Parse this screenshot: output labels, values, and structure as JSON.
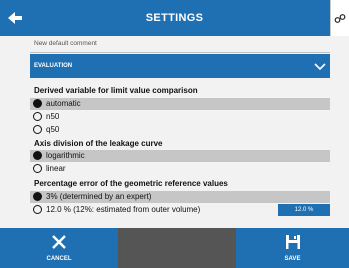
{
  "header": {
    "title": "SETTINGS",
    "back_icon": "back-arrow-icon",
    "corner_icon": "tools-icon"
  },
  "comment": {
    "text": "New default comment"
  },
  "section": {
    "label": "EVALUATION",
    "chevron_icon": "chevron-down-icon"
  },
  "groups": [
    {
      "title": "Derived variable for limit value comparison",
      "options": [
        {
          "label": "automatic",
          "selected": true
        },
        {
          "label": "n50",
          "selected": false
        },
        {
          "label": "q50",
          "selected": false
        }
      ]
    },
    {
      "title": "Axis division of the leakage curve",
      "options": [
        {
          "label": "logarithmic",
          "selected": true
        },
        {
          "label": "linear",
          "selected": false
        }
      ]
    },
    {
      "title": "Percentage error of the geometric reference values",
      "options": [
        {
          "label": "3% (determined by an expert)",
          "selected": true
        },
        {
          "label": "12.0 % (12%: estimated from outer volume)",
          "selected": false
        }
      ]
    }
  ],
  "badge": {
    "value": "12.0 %"
  },
  "footer": {
    "cancel_label": "CANCEL",
    "save_label": "SAVE",
    "cancel_icon": "close-icon",
    "save_icon": "save-icon"
  },
  "colors": {
    "accent": "#1f6fb3",
    "selected_bg": "#c6c6c6",
    "content_bg": "#f2f2f2"
  }
}
